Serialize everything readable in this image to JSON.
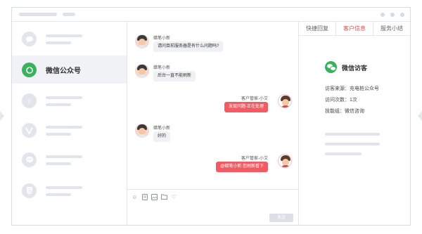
{
  "titlebar": {
    "window_controls": [
      "dot",
      "dot",
      "dot"
    ]
  },
  "sidebar": {
    "items": [
      {
        "icon": "chat-bubble-icon",
        "label": ""
      },
      {
        "icon": "wechat-official-account-icon",
        "label": "微信公众号",
        "active": true
      },
      {
        "icon": "music-note-icon",
        "label": ""
      },
      {
        "icon": "v-logo-icon",
        "label": ""
      },
      {
        "icon": "messenger-icon",
        "label": ""
      },
      {
        "icon": "html5-icon",
        "label": ""
      }
    ]
  },
  "chat": {
    "messages": [
      {
        "sender": "蜡笔小新",
        "text": "请问目前服务器是有什么问题吗?",
        "from": "user"
      },
      {
        "sender": "蜡笔小新",
        "text": "后台一直不能刷新",
        "from": "user"
      },
      {
        "sender": "客户管家-小艾",
        "text": "发现问题-正在处理",
        "from": "agent"
      },
      {
        "sender": "蜡笔小新",
        "text": "好的",
        "from": "user"
      },
      {
        "sender": "客户管家-小艾",
        "text": "@蜡笔小新 您刷新看下",
        "from": "agent"
      }
    ],
    "toolbar_icons": [
      "emoji-icon",
      "file-icon",
      "image-icon",
      "folder-icon",
      "heart-icon"
    ],
    "send_label": "发送"
  },
  "info_panel": {
    "tabs": [
      {
        "label": "快捷回复"
      },
      {
        "label": "客户信息",
        "active": true
      },
      {
        "label": "服务小结"
      }
    ],
    "visitor_title": "微信访客",
    "rows": [
      {
        "text": "访客来源：充电桩公众号"
      },
      {
        "text": "访问次数：1次"
      },
      {
        "text": "技能组：微信咨询"
      }
    ]
  },
  "colors": {
    "accent": "#f25b63",
    "active_tab": "#e8484f",
    "wechat_green": "#39b25b",
    "skeleton": "#e1e4ec"
  }
}
